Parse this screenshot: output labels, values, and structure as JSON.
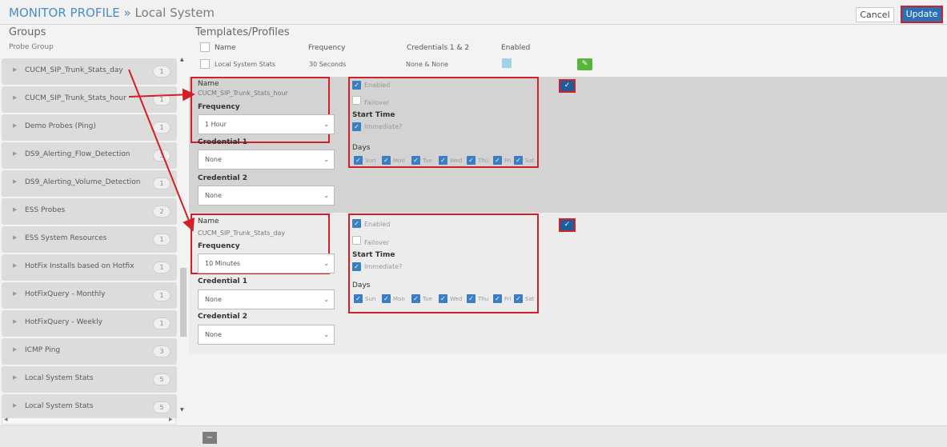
{
  "header": {
    "title": "MONITOR PROFILE",
    "separator": "»",
    "subtitle": "Local System",
    "cancel_label": "Cancel",
    "update_label": "Update"
  },
  "groups": {
    "title": "Groups",
    "column": "Probe Group",
    "items": [
      {
        "label": "CUCM_SIP_Trunk_Stats_day",
        "count": "1"
      },
      {
        "label": "CUCM_SIP_Trunk_Stats_hour",
        "count": "1"
      },
      {
        "label": "Demo Probes (Ping)",
        "count": "1"
      },
      {
        "label": "DS9_Alerting_Flow_Detection",
        "count": "3"
      },
      {
        "label": "DS9_Alerting_Volume_Detection",
        "count": "1"
      },
      {
        "label": "ESS Probes",
        "count": "2"
      },
      {
        "label": "ESS System Resources",
        "count": "1"
      },
      {
        "label": "HotFix Installs based on Hotfix",
        "count": "1"
      },
      {
        "label": "HotFixQuery - Monthly",
        "count": "1"
      },
      {
        "label": "HotFixQuery - Weekly",
        "count": "1"
      },
      {
        "label": "ICMP Ping",
        "count": "3"
      },
      {
        "label": "Local System Stats",
        "count": "5"
      },
      {
        "label": "Local System Stats",
        "count": "5"
      }
    ]
  },
  "templates": {
    "title": "Templates/Profiles",
    "columns": {
      "name": "Name",
      "frequency": "Frequency",
      "credentials": "Credentials 1 & 2",
      "enabled": "Enabled"
    },
    "row": {
      "name": "Local System Stats",
      "frequency": "30 Seconds",
      "credentials": "None & None"
    }
  },
  "labels": {
    "name": "Name",
    "frequency": "Frequency",
    "credential1": "Credential 1",
    "credential2": "Credential 2",
    "enabled": "Enabled",
    "failover": "Failover",
    "start_time": "Start Time",
    "immediate": "Immediate?",
    "days": "Days",
    "day_names": [
      "Sun",
      "Mon",
      "Tue",
      "Wed",
      "Thu",
      "Fri",
      "Sat"
    ]
  },
  "profiles": [
    {
      "name": "CUCM_SIP_Trunk_Stats_hour",
      "frequency": "1 Hour",
      "credential1": "None",
      "credential2": "None"
    },
    {
      "name": "CUCM_SIP_Trunk_Stats_day",
      "frequency": "10 Minutes",
      "credential1": "None",
      "credential2": "None"
    }
  ]
}
